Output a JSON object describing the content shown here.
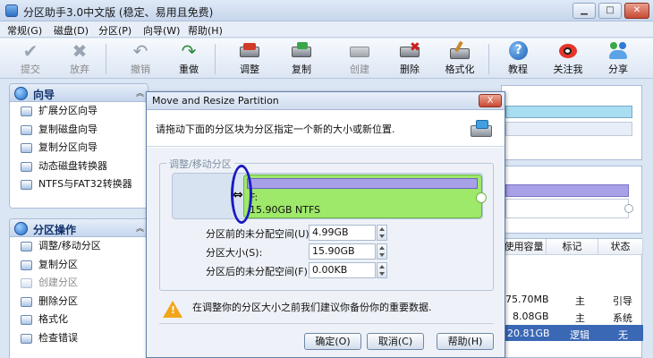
{
  "window": {
    "title": "分区助手3.0中文版 (稳定、易用且免费)"
  },
  "menu": [
    "常规(G)",
    "磁盘(D)",
    "分区(P)",
    "向导(W)",
    "帮助(H)"
  ],
  "toolbar": {
    "items": [
      {
        "label": "提交",
        "icon": "check-icon",
        "enabled": false
      },
      {
        "label": "放弃",
        "icon": "x-icon",
        "enabled": false
      },
      {
        "label": "撤销",
        "icon": "undo-icon",
        "enabled": false
      },
      {
        "label": "重做",
        "icon": "redo-icon",
        "enabled": true
      },
      {
        "label": "调整",
        "icon": "resize-icon",
        "enabled": true
      },
      {
        "label": "复制",
        "icon": "copy-icon",
        "enabled": true
      },
      {
        "label": "创建",
        "icon": "create-icon",
        "enabled": false
      },
      {
        "label": "删除",
        "icon": "delete-icon",
        "enabled": true
      },
      {
        "label": "格式化",
        "icon": "format-icon",
        "enabled": true
      },
      {
        "label": "教程",
        "icon": "help-icon",
        "enabled": true
      },
      {
        "label": "关注我",
        "icon": "weibo-icon",
        "enabled": true
      },
      {
        "label": "分享",
        "icon": "share-icon",
        "enabled": true
      }
    ]
  },
  "wizard_panel": {
    "title": "向导",
    "items": [
      "扩展分区向导",
      "复制磁盘向导",
      "复制分区向导",
      "动态磁盘转换器",
      "NTFS与FAT32转换器"
    ]
  },
  "partition_panel": {
    "title": "分区操作",
    "items": [
      {
        "label": "调整/移动分区",
        "enabled": true
      },
      {
        "label": "复制分区",
        "enabled": true
      },
      {
        "label": "创建分区",
        "enabled": false
      },
      {
        "label": "删除分区",
        "enabled": true
      },
      {
        "label": "格式化",
        "enabled": true
      },
      {
        "label": "检查错误",
        "enabled": true
      }
    ]
  },
  "table": {
    "headers": [
      "使用容量",
      "标记",
      "状态"
    ],
    "rows": [
      {
        "used": "75.70MB",
        "flag": "主",
        "status": "引导"
      },
      {
        "used": "8.08GB",
        "flag": "主",
        "status": "系统"
      },
      {
        "used": "20.81GB",
        "flag": "逻辑",
        "status": "无"
      }
    ]
  },
  "dialog": {
    "title": "Move and Resize Partition",
    "close": "X",
    "description": "请拖动下面的分区块为分区指定一个新的大小或新位置.",
    "group_label": "调整/移动分区",
    "partition_label_line1": "F:",
    "partition_label_line2": "15.90GB NTFS",
    "fields": [
      {
        "label": "分区前的未分配空间(U):",
        "value": "4.99GB"
      },
      {
        "label": "分区大小(S):",
        "value": "15.90GB"
      },
      {
        "label": "分区后的未分配空间(F):",
        "value": "0.00KB"
      }
    ],
    "warning": "在调整你的分区大小之前我们建议你备份你的重要数据.",
    "buttons": {
      "ok": "确定(O)",
      "cancel": "取消(C)",
      "help": "帮助(H)"
    }
  },
  "colors": {
    "partition_fill": "#9ee86a",
    "partition_bar": "#a9a1e8",
    "highlight_ellipse": "#1a1ac0"
  }
}
